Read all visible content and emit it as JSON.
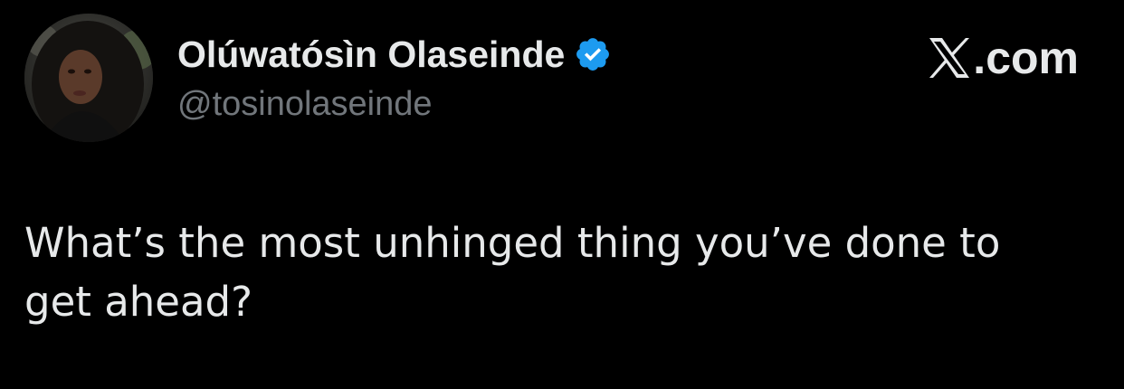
{
  "tweet": {
    "author": {
      "display_name": "Olúwatósìn Olaseinde",
      "handle": "@tosinolaseinde",
      "verified": true,
      "avatar_icon": "profile-photo",
      "verified_icon": "verified-badge-icon"
    },
    "brand": {
      "logo_icon": "x-logo-icon",
      "text": ".com"
    },
    "text_line_1": "What’s the most unhinged thing you’ve done to",
    "text_line_2": "get ahead?"
  },
  "colors": {
    "background": "#000000",
    "primary_text": "#e7e9ea",
    "secondary_text": "#71767b",
    "verified_blue": "#1d9bf0"
  }
}
